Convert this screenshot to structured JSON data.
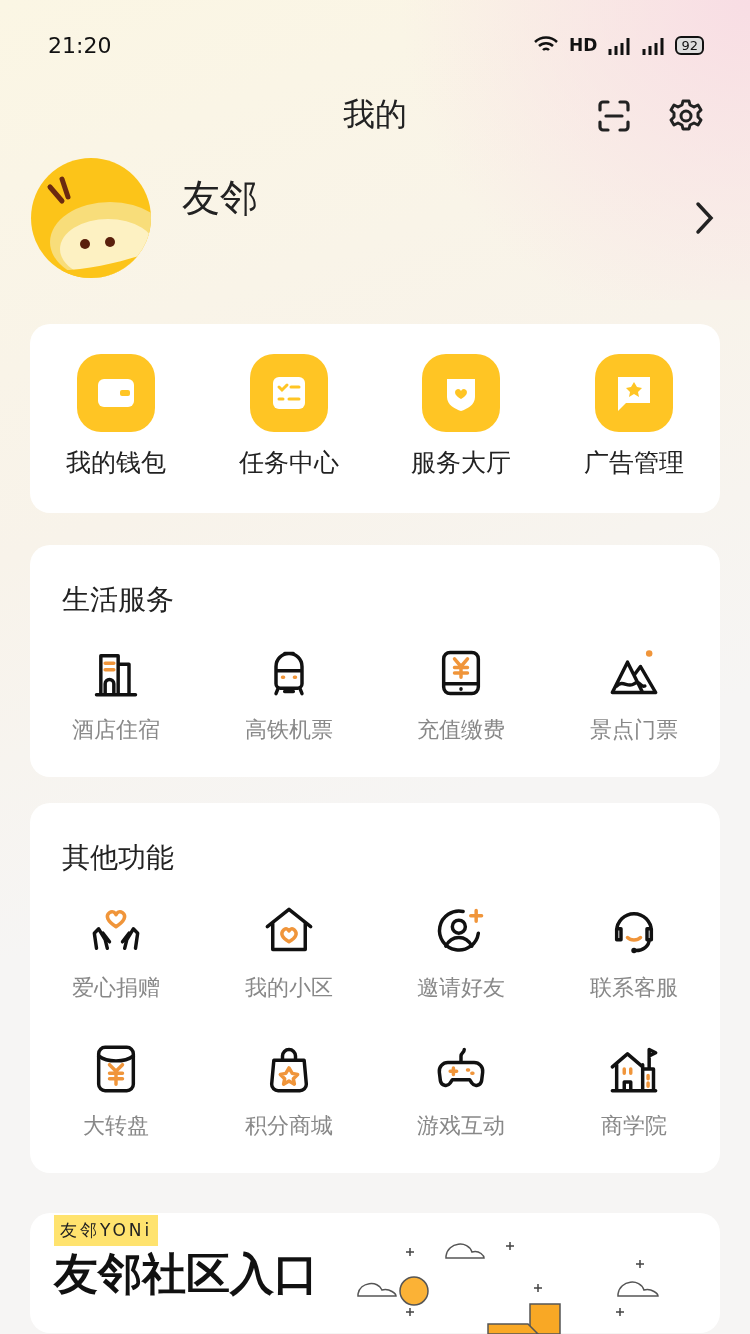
{
  "status_bar": {
    "time": "21:20",
    "network": "HD",
    "battery": "92"
  },
  "header": {
    "title": "我的"
  },
  "profile": {
    "name": "友邻"
  },
  "quick_actions": [
    {
      "label": "我的钱包"
    },
    {
      "label": "任务中心"
    },
    {
      "label": "服务大厅"
    },
    {
      "label": "广告管理"
    }
  ],
  "life_services": {
    "title": "生活服务",
    "items": [
      {
        "label": "酒店住宿"
      },
      {
        "label": "高铁机票"
      },
      {
        "label": "充值缴费"
      },
      {
        "label": "景点门票"
      }
    ]
  },
  "other_functions": {
    "title": "其他功能",
    "items": [
      {
        "label": "爱心捐赠"
      },
      {
        "label": "我的小区"
      },
      {
        "label": "邀请好友"
      },
      {
        "label": "联系客服"
      },
      {
        "label": "大转盘"
      },
      {
        "label": "积分商城"
      },
      {
        "label": "游戏互动"
      },
      {
        "label": "商学院"
      }
    ]
  },
  "banner": {
    "tag": "友邻YONi",
    "title": "友邻社区入口"
  }
}
